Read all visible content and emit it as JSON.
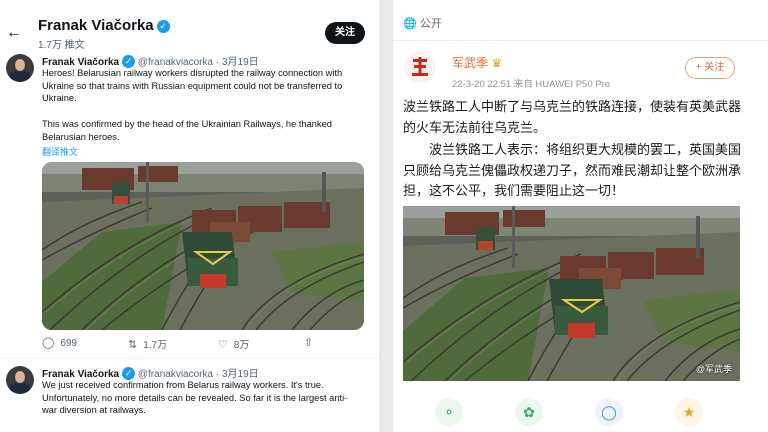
{
  "twitter": {
    "header": {
      "name": "Franak Viačorka",
      "followers": "1.7万 推文",
      "follow_label": "关注",
      "back_icon": "arrow-left-icon"
    },
    "tweets": [
      {
        "name": "Franak Viačorka",
        "handle": "@franakviacorka · 3月19日",
        "text": "Heroes! Belarusian railway workers disrupted the railway connection with Ukraine so that trains with Russian equipment could not be transferred to Ukraine.",
        "text2": "This was confirmed by the head of the Ukrainian Railways, he thanked Belarusian heroes.",
        "translate": "翻译推文",
        "actions": {
          "replies": "699",
          "retweets": "1.7万",
          "likes": "8万"
        }
      },
      {
        "name": "Franak Viačorka",
        "handle": "@franakviacorka · 3月19日",
        "text": "We just received confirmation from Belarus railway workers. It's true. Unfortunately, no more details can be revealed. So far it is the largest anti-war diversion at railways."
      }
    ]
  },
  "weibo": {
    "public_label": "公开",
    "user": {
      "name": "军武季",
      "info": "22-3-20 22:51  来自 HUAWEI P50 Pro",
      "follow_label": "+ 关注"
    },
    "text1": "波兰铁路工人中断了与乌克兰的铁路连接，使装有英美武器的火车无法前往乌克兰。",
    "text2": "波兰铁路工人表示：将组织更大规模的罢工，英国美国只顾给乌克兰傀儡政权递刀子，然而难民潮却让整个欧洲承担，这不公平，我们需要阻止这一切！",
    "watermark": "@军武季",
    "share_icons": [
      "wechat-icon",
      "moments-icon",
      "qq-icon",
      "qzone-icon"
    ]
  },
  "colors": {
    "twitter_blue": "#1d9bf0",
    "weibo_orange": "#e86a2a"
  }
}
